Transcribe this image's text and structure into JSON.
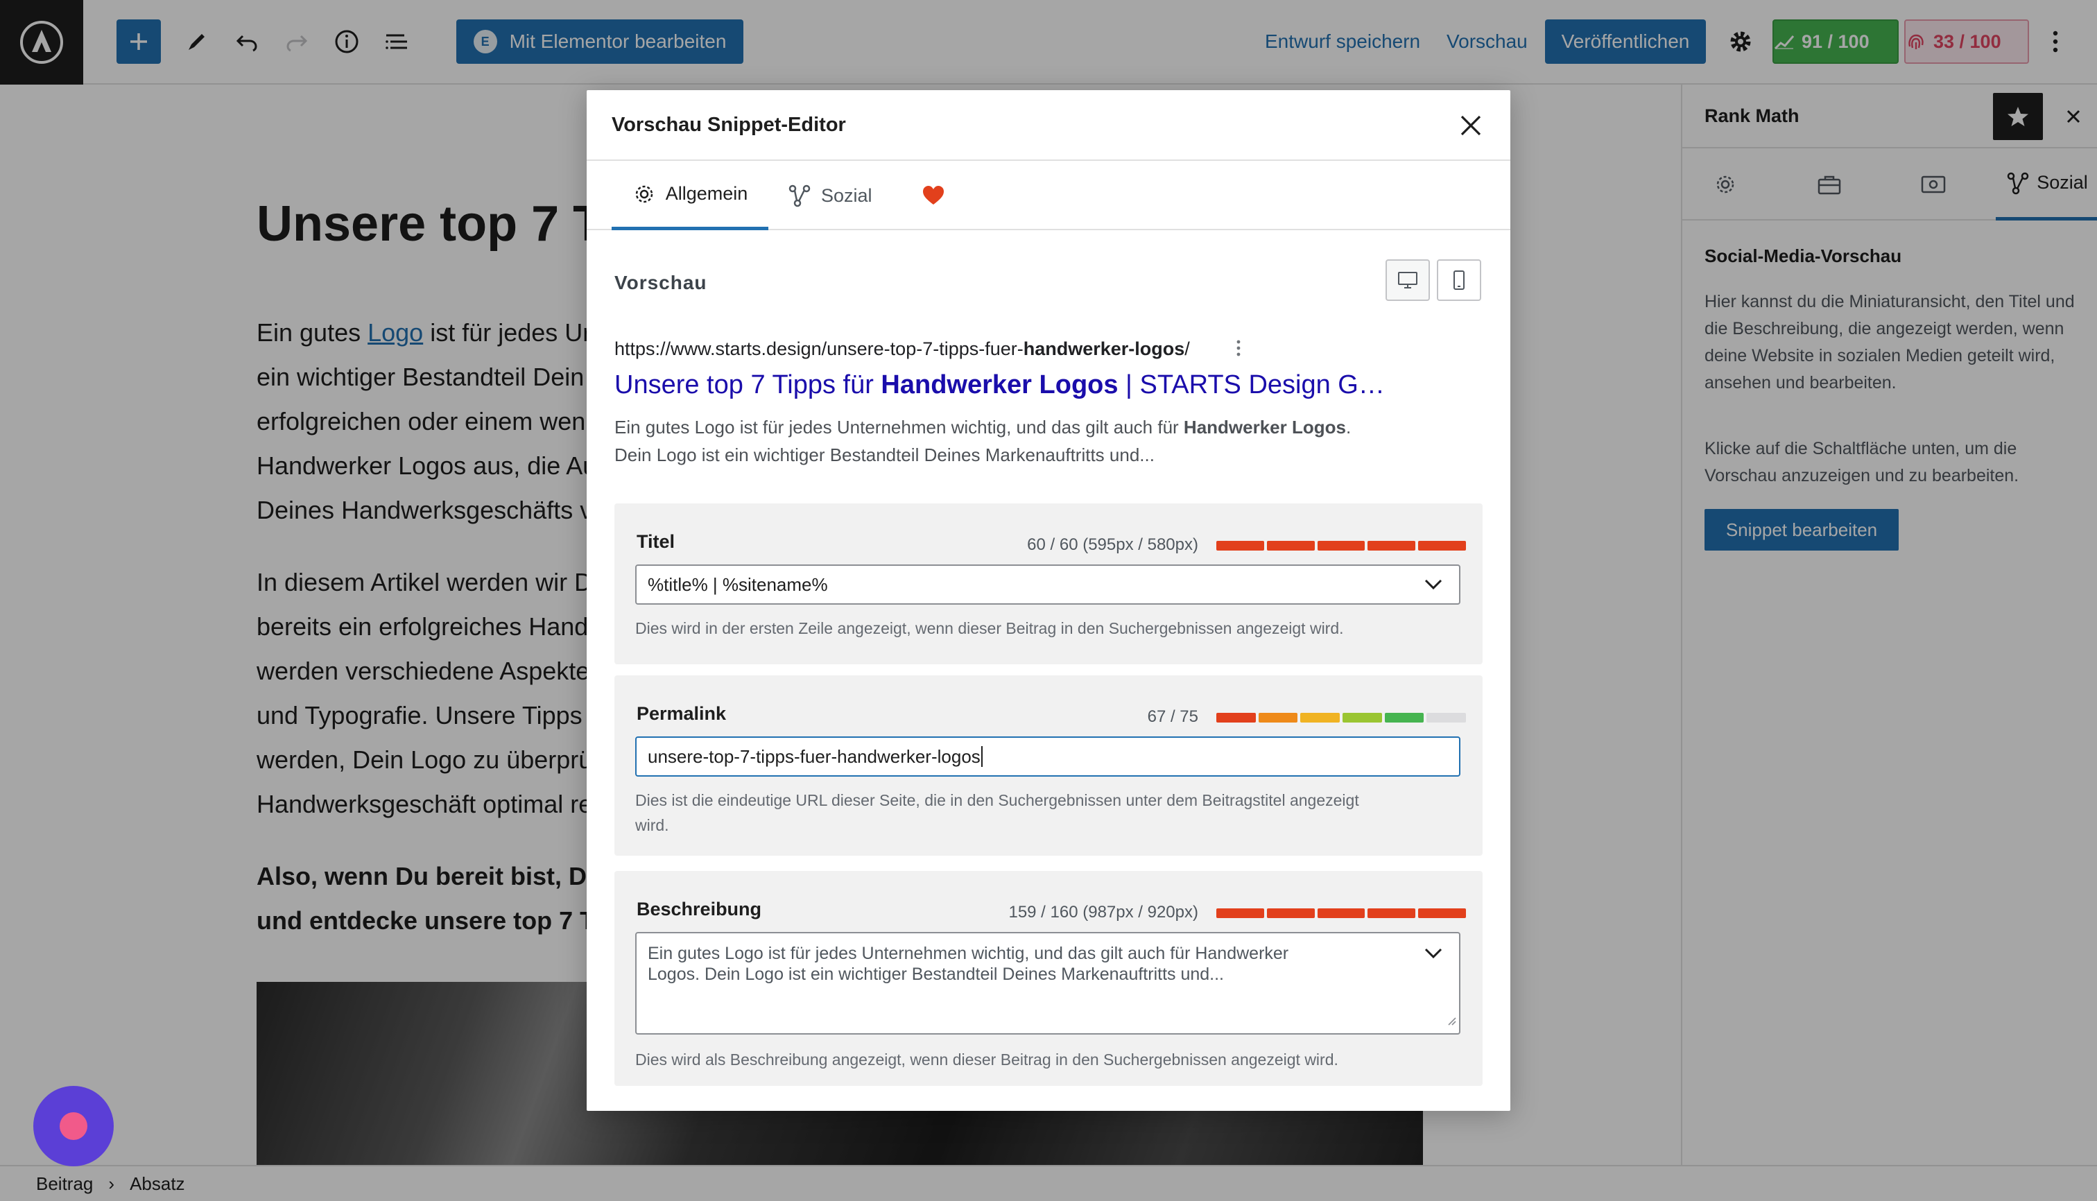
{
  "toolbar": {
    "elementor_label": "Mit Elementor bearbeiten",
    "save_draft": "Entwurf speichern",
    "preview": "Vorschau",
    "publish": "Veröffentlichen",
    "seo_score": "91 / 100",
    "readability_score": "33 / 100",
    "icons": [
      "wp-logo-icon",
      "plus-icon",
      "pencil-icon",
      "undo-icon",
      "redo-icon",
      "info-icon",
      "list-view-icon",
      "gear-icon",
      "more-vertical-icon"
    ]
  },
  "editor": {
    "post_title": "Unsere top 7 T",
    "paragraph1": {
      "line1_pre": "Ein gutes ",
      "line1_link": "Logo",
      "line1_post": " ist für jedes Ur",
      "line2": "ein wichtiger Bestandteil Dein",
      "line3": "erfolgreichen oder einem wen",
      "line4": "Handwerker Logos aus, die Au",
      "line5": "Deines Handwerksgeschäfts v"
    },
    "paragraph2": {
      "line1": "In diesem Artikel werden wir D",
      "line2": "bereits ein erfolgreiches Hand",
      "line3": "werden verschiedene Aspekte",
      "line4": "und Typografie. Unsere Tipps",
      "line5": "werden, Dein Logo zu überprü",
      "line6": "Handwerksgeschäft optimal re"
    },
    "paragraph3": {
      "line1": "Also, wenn Du bereit bist, De",
      "line2": "und entdecke unsere top 7 T"
    }
  },
  "sidebar": {
    "title": "Rank Math",
    "tab_social": "Sozial",
    "section_title": "Social-Media-Vorschau",
    "text1": "Hier kannst du die Miniaturansicht, den Titel und die Beschreibung, die angezeigt werden, wenn deine Website in sozialen Medien geteilt wird, ansehen und bearbeiten.",
    "text2": "Klicke auf die Schaltfläche unten, um die Vorschau anzuzeigen und zu bearbeiten.",
    "edit_snippet": "Snippet bearbeiten"
  },
  "statusbar": {
    "crumb1": "Beitrag",
    "separator": "›",
    "crumb2": "Absatz"
  },
  "modal": {
    "title": "Vorschau Snippet-Editor",
    "tabs": {
      "general": "Allgemein",
      "social": "Sozial"
    },
    "preview_label": "Vorschau",
    "serp": {
      "url_pre": "https://www.starts.design/unsere-top-7-tipps-fuer-",
      "url_bold": "handwerker-logos",
      "url_post": "/",
      "title_pre": "Unsere top 7 Tipps für ",
      "title_bold": "Handwerker Logos",
      "title_post": " | STARTS Design G…",
      "desc_line1_pre": "Ein gutes Logo ist für jedes Unternehmen wichtig, und das gilt auch für ",
      "desc_line1_bold": "Handwerker Logos",
      "desc_line1_post": ".",
      "desc_line2": "Dein Logo ist ein wichtiger Bestandteil Deines Markenauftritts und..."
    },
    "fields": {
      "title": {
        "label": "Titel",
        "count": "60 / 60 (595px / 580px)",
        "value": "%title% | %sitename%",
        "help": "Dies wird in der ersten Zeile angezeigt, wenn dieser Beitrag in den Suchergebnissen angezeigt wird.",
        "meter_colors": [
          "#e2401c",
          "#e2401c",
          "#e2401c",
          "#e2401c",
          "#e2401c"
        ]
      },
      "permalink": {
        "label": "Permalink",
        "count": "67 / 75",
        "value": "unsere-top-7-tipps-fuer-handwerker-logos",
        "help_line1": "Dies ist die eindeutige URL dieser Seite, die in den Suchergebnissen unter dem Beitragstitel angezeigt",
        "help_line2": "wird.",
        "meter_colors": [
          "#e2401c",
          "#ee8a1a",
          "#f0b323",
          "#9ac532",
          "#46b450",
          "#dcdcde"
        ]
      },
      "description": {
        "label": "Beschreibung",
        "count": "159 / 160 (987px / 920px)",
        "value_line1": "Ein gutes Logo ist für jedes Unternehmen wichtig, und das gilt auch für Handwerker",
        "value_line2": "Logos. Dein Logo ist ein wichtiger Bestandteil Deines Markenauftritts und...",
        "help": "Dies wird als Beschreibung angezeigt, wenn dieser Beitrag in den Suchergebnissen angezeigt wird.",
        "meter_colors": [
          "#e2401c",
          "#e2401c",
          "#e2401c",
          "#e2401c",
          "#e2401c"
        ]
      }
    }
  },
  "colors": {
    "accent": "#2271b1",
    "serp_title": "#1a0dab",
    "seo_good": "#46b450",
    "readability_bad": "#e04462",
    "heart": "#e2401c"
  }
}
